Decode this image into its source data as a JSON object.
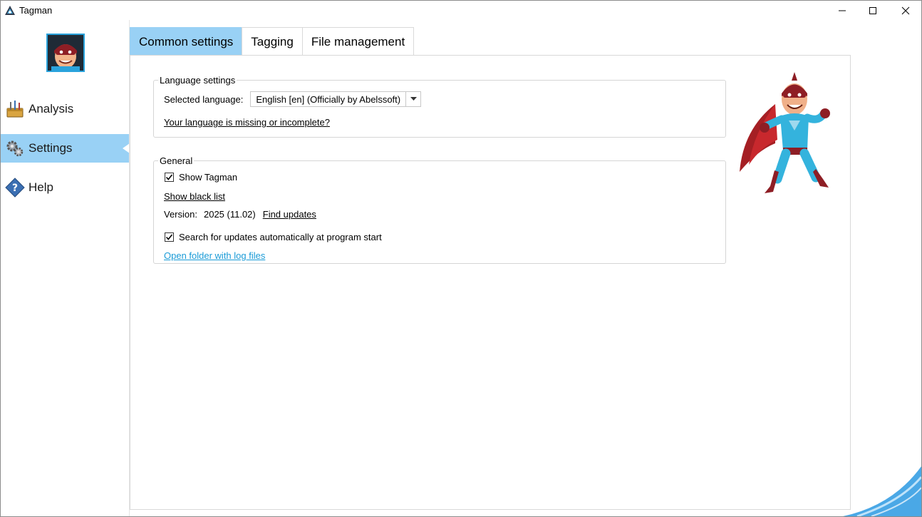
{
  "window": {
    "title": "Tagman",
    "controls": {
      "minimize": "minimize-icon",
      "maximize": "maximize-icon",
      "close": "close-icon"
    }
  },
  "sidebar": {
    "items": [
      {
        "label": "Analysis",
        "icon": "toolbox-icon"
      },
      {
        "label": "Settings",
        "icon": "gears-icon",
        "active": true
      },
      {
        "label": "Help",
        "icon": "help-diamond-icon"
      }
    ]
  },
  "tabs": [
    {
      "label": "Common settings",
      "active": true
    },
    {
      "label": "Tagging"
    },
    {
      "label": "File management"
    }
  ],
  "language_settings": {
    "title": "Language settings",
    "selected_language_label": "Selected language:",
    "selected_language_value": "English [en]  (Officially by Abelssoft)",
    "missing_link": "Your language is missing or incomplete?"
  },
  "general": {
    "title": "General",
    "show_tagman_label": "Show Tagman",
    "show_tagman_checked": true,
    "black_list_link": "Show black list",
    "version_label": "Version:",
    "version_value": "2025 (11.02)",
    "find_updates_link": "Find updates",
    "auto_update_label": "Search for updates automatically at program start",
    "auto_update_checked": true,
    "log_folder_link": "Open folder with log files"
  },
  "colors": {
    "accent": "#99d1f5",
    "link_blue": "#1a9bd7",
    "avatar_border": "#2aa3dc"
  }
}
